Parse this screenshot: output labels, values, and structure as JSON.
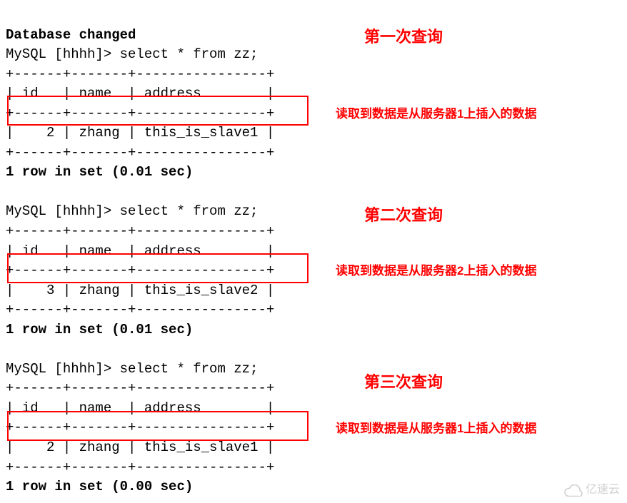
{
  "header_line": "Database changed",
  "queries": [
    {
      "prompt": "MySQL [hhhh]> select * from zz;",
      "border": "+------+-------+----------------+",
      "header": "| id   | name  | address        |",
      "row": "|    2 | zhang | this_is_slave1 |",
      "footer": "1 row in set (0.01 sec)",
      "title": "第一次查询",
      "note": "读取到数据是从服务器1上插入的数据"
    },
    {
      "prompt": "MySQL [hhhh]> select * from zz;",
      "border": "+------+-------+----------------+",
      "header": "| id   | name  | address        |",
      "row": "|    3 | zhang | this_is_slave2 |",
      "footer": "1 row in set (0.01 sec)",
      "title": "第二次查询",
      "note": "读取到数据是从服务器2上插入的数据"
    },
    {
      "prompt": "MySQL [hhhh]> select * from zz;",
      "border": "+------+-------+----------------+",
      "header": "| id   | name  | address        |",
      "row": "|    2 | zhang | this_is_slave1 |",
      "footer": "1 row in set (0.00 sec)",
      "title": "第三次查询",
      "note": "读取到数据是从服务器1上插入的数据"
    }
  ],
  "watermark": "亿速云"
}
